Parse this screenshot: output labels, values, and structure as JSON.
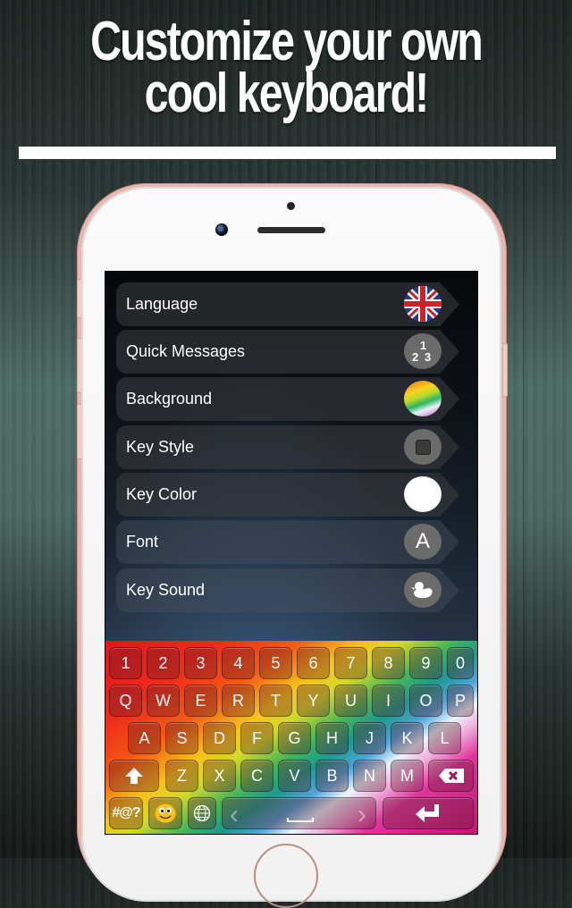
{
  "headline": {
    "line1": "Customize your own",
    "line2": "cool keyboard!"
  },
  "settings_menu": [
    {
      "label": "Language",
      "icon": "uk-flag-icon",
      "icon_text": ""
    },
    {
      "label": "Quick Messages",
      "icon": "numbers-123-icon",
      "icon_text": "1 2 3"
    },
    {
      "label": "Background",
      "icon": "rainbow-swatch-icon",
      "icon_text": ""
    },
    {
      "label": "Key Style",
      "icon": "square-key-icon",
      "icon_text": ""
    },
    {
      "label": "Key Color",
      "icon": "white-color-swatch-icon",
      "icon_text": ""
    },
    {
      "label": "Font",
      "icon": "font-letter-icon",
      "icon_text": "A"
    },
    {
      "label": "Key Sound",
      "icon": "duck-icon",
      "icon_text": ""
    }
  ],
  "keyboard": {
    "row1": [
      "1",
      "2",
      "3",
      "4",
      "5",
      "6",
      "7",
      "8",
      "9",
      "0"
    ],
    "row2": [
      "Q",
      "W",
      "E",
      "R",
      "T",
      "Y",
      "U",
      "I",
      "O",
      "P"
    ],
    "row3": [
      "A",
      "S",
      "D",
      "F",
      "G",
      "H",
      "J",
      "K",
      "L"
    ],
    "row4": [
      "Z",
      "X",
      "C",
      "V",
      "B",
      "N",
      "M"
    ],
    "symbols_label": "#@?",
    "space_label": "⎵",
    "left_arrow": "‹",
    "right_arrow": "›"
  },
  "colors": {
    "accent_rose_gold": "#e9b7ae",
    "rule": "#ffffff"
  }
}
